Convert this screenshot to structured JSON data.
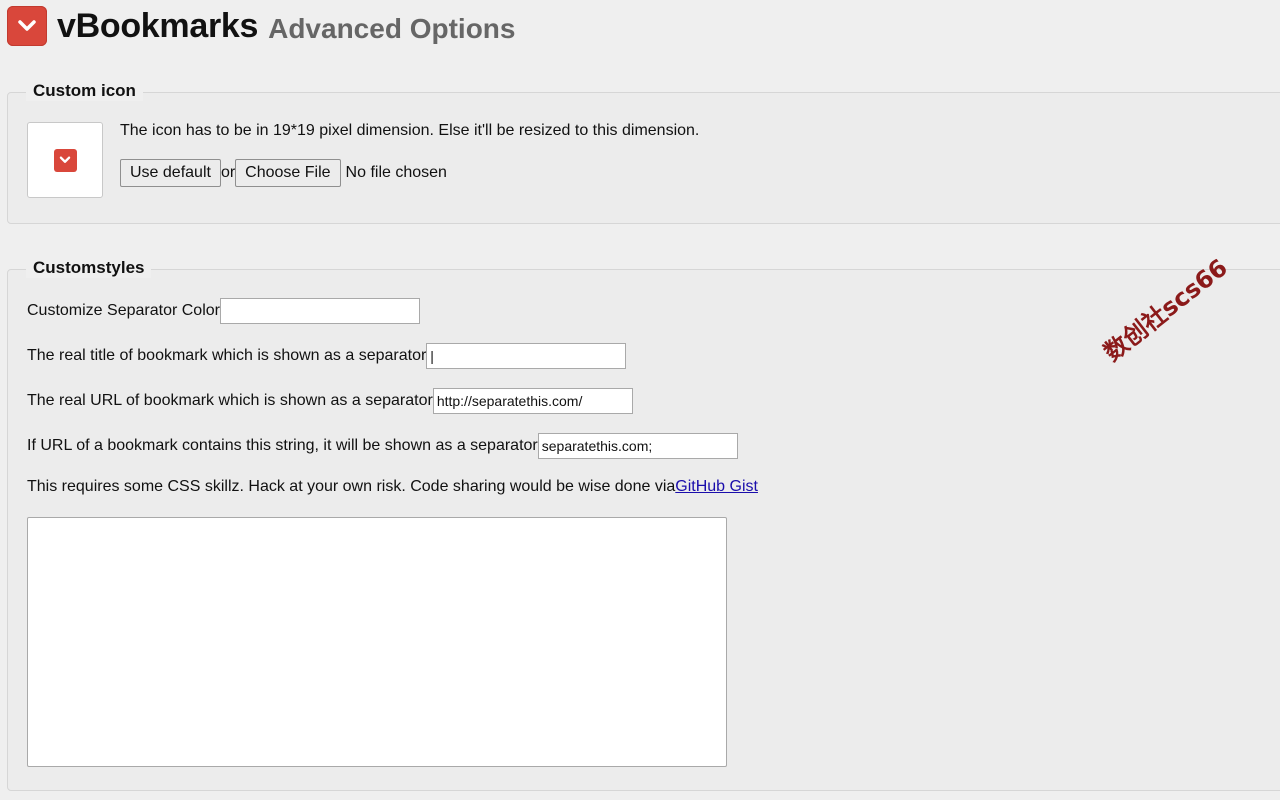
{
  "header": {
    "app_name": "vBookmarks",
    "subtitle": "Advanced Options"
  },
  "custom_icon": {
    "legend": "Custom icon",
    "note": "The icon has to be in 19*19 pixel dimension. Else it'll be resized to this dimension.",
    "use_default_label": "Use default",
    "or_text": "or",
    "choose_file_label": "Choose File",
    "file_status": "No file chosen"
  },
  "custom_styles": {
    "legend": "Customstyles",
    "separator_color_label": "Customize Separator Color",
    "separator_color_value": "",
    "separator_title_label": "The real title of bookmark which is shown as a separator",
    "separator_title_value": "|",
    "separator_url_label": "The real URL of bookmark which is shown as a separator",
    "separator_url_value": "http://separatethis.com/",
    "separator_string_label": "If URL of a bookmark contains this string, it will be shown as a separator",
    "separator_string_value": "separatethis.com;",
    "css_note": "This requires some CSS skillz. Hack at your own risk. Code sharing would be wise done via",
    "css_link": "GitHub Gist",
    "css_value": ""
  },
  "watermark": "数创社scs66",
  "colors": {
    "brand": "#d9473b",
    "background": "#efefef",
    "link": "#1a0dab"
  },
  "icons": [
    "chevron-down-icon"
  ]
}
